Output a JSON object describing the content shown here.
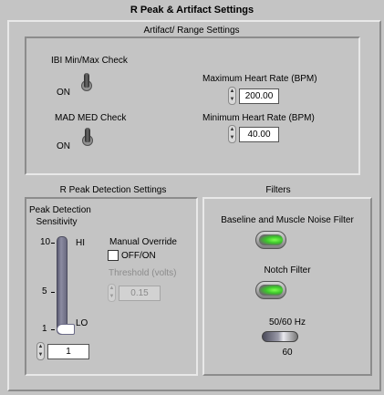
{
  "title": "R Peak & Artifact Settings",
  "artifact": {
    "section_title": "Artifact/ Range Settings",
    "ibi_label": "IBI Min/Max Check",
    "ibi_state": "ON",
    "mad_label": "MAD MED Check",
    "mad_state": "ON",
    "max_hr_label": "Maximum Heart Rate (BPM)",
    "max_hr_value": "200.00",
    "min_hr_label": "Minimum Heart Rate (BPM)",
    "min_hr_value": "40.00"
  },
  "rpeak": {
    "section_title": "R Peak Detection Settings",
    "sensitivity_label_1": "Peak Detection",
    "sensitivity_label_2": "Sensitivity",
    "slider_ticks": [
      "10",
      "5",
      "1"
    ],
    "hi_label": "HI",
    "lo_label": "LO",
    "sensitivity_value": "1",
    "sensitivity_fraction": 0.0,
    "manual_override_label": "Manual Override",
    "off_on_label": "OFF/ON",
    "manual_override_checked": false,
    "threshold_label": "Threshold (volts)",
    "threshold_value": "0.15"
  },
  "filters": {
    "section_title": "Filters",
    "baseline_label": "Baseline and Muscle Noise Filter",
    "baseline_on": true,
    "notch_label": "Notch Filter",
    "notch_on": true,
    "hz_label": "50/60 Hz",
    "hz_value": "60"
  },
  "colors": {
    "background": "#c4c4c4",
    "led_on": "#3bc52a",
    "slider": "#7b7b94"
  },
  "icons": {
    "spinner": "up-down-arrows-icon",
    "led": "led-indicator-icon"
  }
}
